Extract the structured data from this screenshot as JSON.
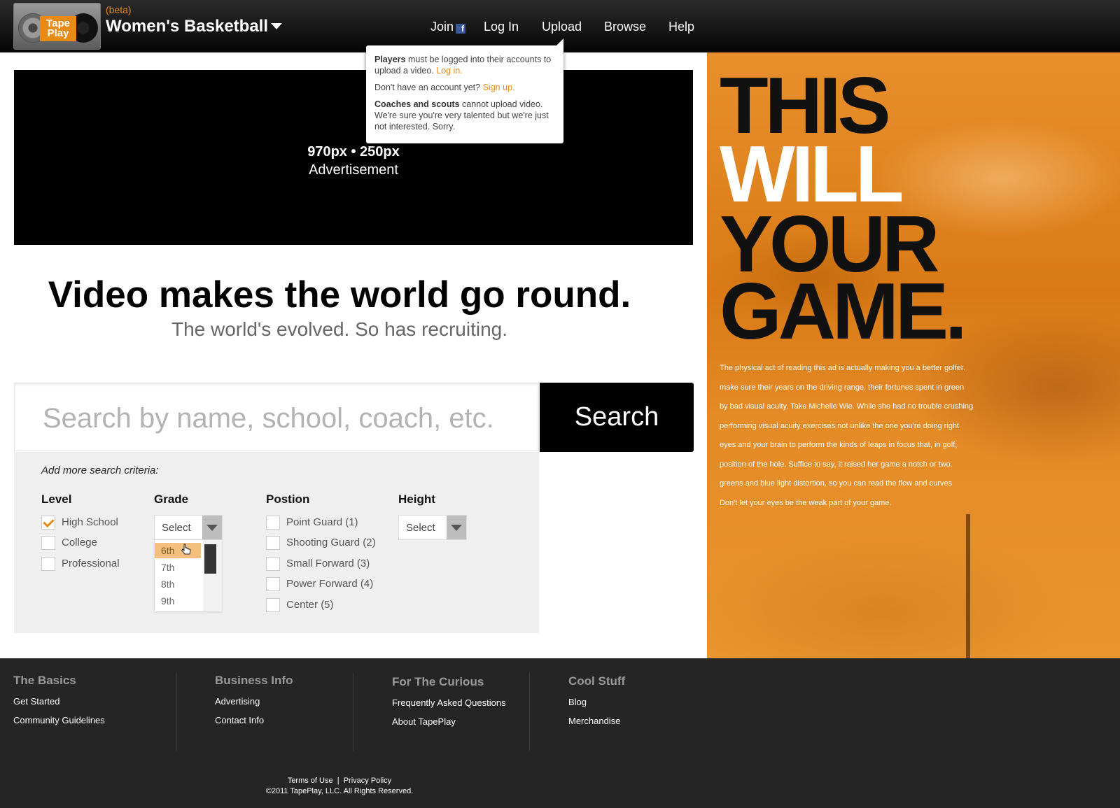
{
  "header": {
    "logo_text": "Tape Play",
    "beta": "(beta)",
    "title": "Women's Basketball",
    "nav": {
      "join": "Join",
      "login": "Log In",
      "upload": "Upload",
      "browse": "Browse",
      "help": "Help"
    }
  },
  "tooltip": {
    "p1_bold": "Players",
    "p1_text": " must be logged into their accounts to upload a video. ",
    "p1_link": "Log in.",
    "p2_text": "Don't have an account yet? ",
    "p2_link": "Sign up.",
    "p3_bold": "Coaches and scouts",
    "p3_text": " cannot upload video. We're sure you're very talented but we're just not interested. Sorry."
  },
  "ad": {
    "dimensions": "970px • 250px",
    "label": "Advertisement"
  },
  "hero": {
    "headline": "Video makes the world go round.",
    "subhead": "The world's evolved. So has recruiting."
  },
  "search": {
    "placeholder": "Search by name, school, coach, etc.",
    "button": "Search"
  },
  "criteria": {
    "title": "Add more search criteria:",
    "level": {
      "heading": "Level",
      "options": [
        {
          "label": "High School",
          "checked": true
        },
        {
          "label": "College",
          "checked": false
        },
        {
          "label": "Professional",
          "checked": false
        }
      ]
    },
    "grade": {
      "heading": "Grade",
      "selected": "Select",
      "options": [
        "6th",
        "7th",
        "8th",
        "9th"
      ],
      "highlighted": "6th"
    },
    "position": {
      "heading": "Postion",
      "options": [
        {
          "label": "Point Guard (1)",
          "checked": false
        },
        {
          "label": "Shooting Guard (2)",
          "checked": false
        },
        {
          "label": "Small Forward (3)",
          "checked": false
        },
        {
          "label": "Power Forward (4)",
          "checked": false
        },
        {
          "label": "Center (5)",
          "checked": false
        }
      ]
    },
    "height": {
      "heading": "Height",
      "selected": "Select"
    }
  },
  "side_ad": {
    "line1": "THIS",
    "line2": "WILL",
    "line3": "YOUR",
    "line4": "GAME.",
    "copy": [
      "The physical act of reading this ad is actually making you a better golfer.",
      "make sure their years on the  driving range, their fortunes spent in green",
      "by bad visual acuity. Take Michelle Wie. While she had no trouble crushing",
      "performing visual acuity exercises not unlike the one you're doing right",
      "eyes and your brain to perform the kinds of leaps in focus that, in golf,",
      "position of the hole. Suffice to say, it raised her game a notch or two.",
      "greens and blue light distortion, so you can read the flow and curves",
      "Don't let your eyes be the weak part of your game."
    ]
  },
  "footer": {
    "cols": [
      {
        "heading": "The Basics",
        "links": [
          "Get Started",
          "Community Guidelines"
        ]
      },
      {
        "heading": "Business Info",
        "links": [
          "Advertising",
          "Contact Info"
        ]
      },
      {
        "heading": "For The Curious",
        "links": [
          "Frequently Asked Questions",
          "About TapePlay"
        ]
      },
      {
        "heading": "Cool Stuff",
        "links": [
          "Blog",
          "Merchandise"
        ]
      }
    ],
    "terms": "Terms of Use",
    "sep": "|",
    "privacy": "Privacy Policy",
    "copyright": "©2011 TapePlay, LLC. All Rights Reserved."
  },
  "colors": {
    "accent": "#e88a16",
    "footer_bg": "#252525",
    "header_bg": "#0a0a0a"
  }
}
